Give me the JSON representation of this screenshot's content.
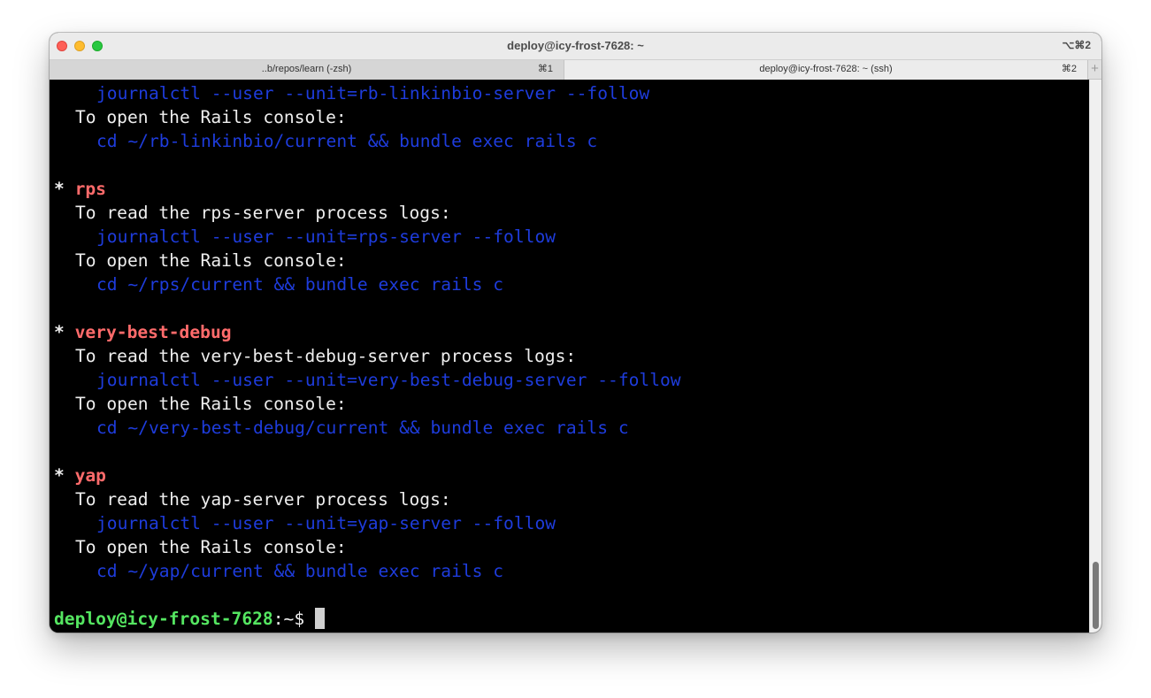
{
  "window": {
    "title": "deploy@icy-frost-7628: ~",
    "shortcut": "⌥⌘2"
  },
  "tabs": [
    {
      "label": "..b/repos/learn (-zsh)",
      "key": "⌘1"
    },
    {
      "label": "deploy@icy-frost-7628: ~ (ssh)",
      "key": "⌘2"
    }
  ],
  "new_tab_icon": "+",
  "colors": {
    "command": "#1e3cdc",
    "app_name": "#ff6b6b",
    "prompt": "#55e661",
    "text": "#eeeeee"
  },
  "terminal": {
    "lines": {
      "l0": "journalctl --user --unit=rb-linkinbio-server --follow",
      "l1": "To open the Rails console:",
      "l2": "cd ~/rb-linkinbio/current && bundle exec rails c",
      "l3_star": "* ",
      "l3_name": "rps",
      "l4": "To read the rps-server process logs:",
      "l5": "journalctl --user --unit=rps-server --follow",
      "l6": "To open the Rails console:",
      "l7": "cd ~/rps/current && bundle exec rails c",
      "l8_star": "* ",
      "l8_name": "very-best-debug",
      "l9": "To read the very-best-debug-server process logs:",
      "l10": "journalctl --user --unit=very-best-debug-server --follow",
      "l11": "To open the Rails console:",
      "l12": "cd ~/very-best-debug/current && bundle exec rails c",
      "l13_star": "* ",
      "l13_name": "yap",
      "l14": "To read the yap-server process logs:",
      "l15": "journalctl --user --unit=yap-server --follow",
      "l16": "To open the Rails console:",
      "l17": "cd ~/yap/current && bundle exec rails c"
    },
    "prompt": {
      "user_host": "deploy@icy-frost-7628",
      "path": ":~",
      "symbol": "$"
    }
  }
}
